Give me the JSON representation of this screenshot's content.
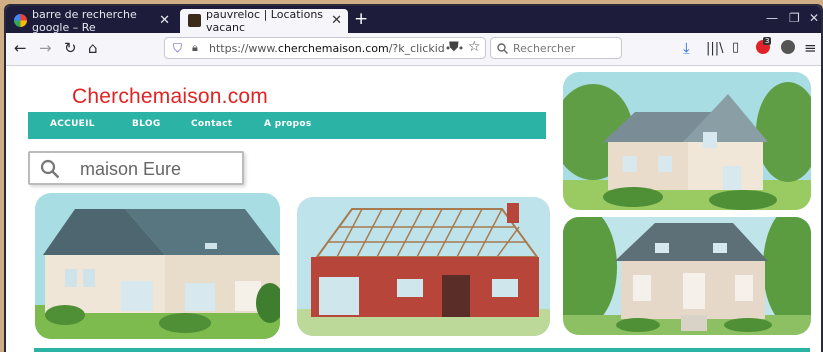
{
  "browser": {
    "tabs": [
      {
        "title": "barre de recherche google – Re",
        "active": false
      },
      {
        "title": "pauvreloc | Locations vacanc",
        "active": true
      }
    ],
    "new_tab_symbol": "+",
    "url_prefix": "https://www.",
    "url_host": "cherchemaison.com",
    "url_path": "/?k_clickid•••",
    "search_placeholder": "Rechercher",
    "badge_count": "3",
    "icons": [
      "back-icon",
      "forward-icon",
      "reload-icon",
      "home-icon",
      "shield-icon",
      "lock-icon",
      "pocket-icon",
      "star-icon",
      "search-icon",
      "download-icon",
      "library-icon",
      "sidebar-icon",
      "extension-icon",
      "account-icon",
      "menu-icon"
    ]
  },
  "site": {
    "logo": "Cherchemaison.com",
    "menu": [
      "ACCUEIL",
      "BLOG",
      "Contact",
      "A propos"
    ],
    "search_value": "maison Eure",
    "accent_color": "#2bb3a6",
    "logo_color": "#e02424"
  }
}
